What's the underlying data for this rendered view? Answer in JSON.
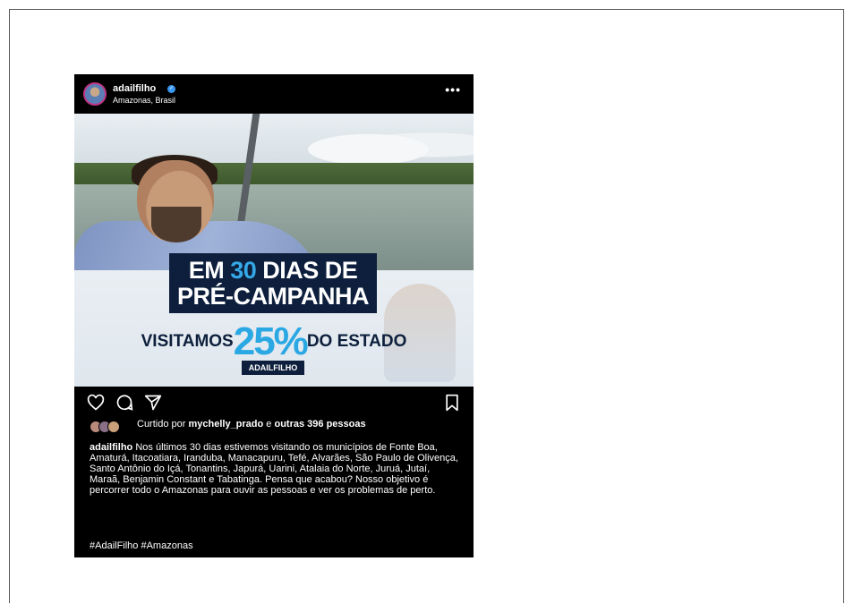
{
  "post": {
    "username": "adailfilho",
    "location": "Amazonas, Brasil",
    "more_label": "•••",
    "image": {
      "line1_pre": "EM ",
      "line1_num": "30",
      "line1_post": " DIAS DE",
      "line2": "PRÉ-CAMPANHA",
      "visit_pre": "VISITAMOS",
      "visit_pct": "25%",
      "visit_post": "DO ESTADO",
      "tag": "ADAILFILHO"
    },
    "likes_prefix": "Curtido por ",
    "likes_user": "mychelly_prado",
    "likes_mid": " e ",
    "likes_rest": "outras 396 pessoas",
    "caption_user": "adailfilho",
    "caption_text": "Nos últimos 30 dias estivemos visitando os municípios de Fonte Boa, Amaturá, Itacoatiara, Iranduba, Manacapuru, Tefé, Alvarães, São Paulo de Olivença, Santo Antônio do Içá, Tonantins, Japurá, Uarini, Atalaia do Norte, Juruá, Jutaí, Maraã, Benjamin Constant e Tabatinga. Pensa que acabou? Nosso objetivo é percorrer todo o Amazonas para ouvir as pessoas e ver os problemas de perto.",
    "hashtags": "#AdailFilho #Amazonas",
    "verified_glyph": "✓"
  },
  "icons": [
    "heart-icon",
    "comment-icon",
    "share-icon",
    "bookmark-icon",
    "verified-icon",
    "more-icon"
  ],
  "colors": {
    "background": "#000000",
    "verified": "#3897f0",
    "accent_blue": "#2aa8e3",
    "navy": "#0d1f3c"
  }
}
